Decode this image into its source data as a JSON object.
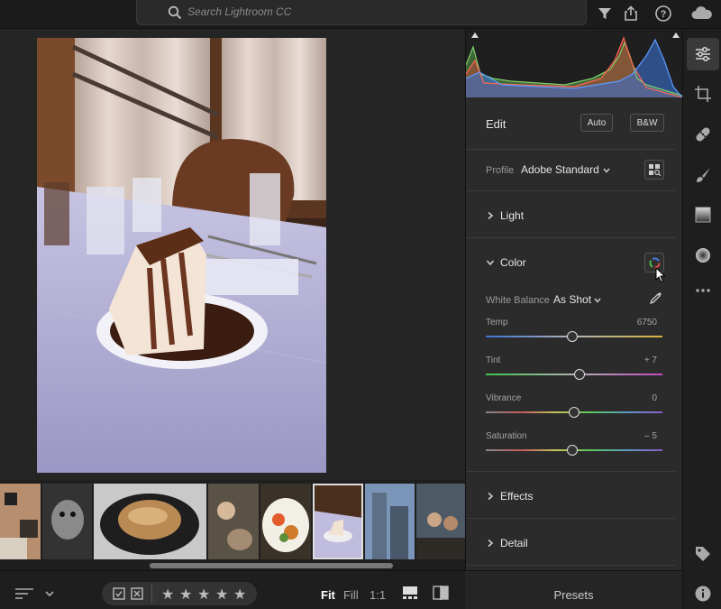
{
  "topbar": {
    "search_placeholder": "Search Lightroom CC",
    "icons": [
      "filter-icon",
      "share-icon",
      "help-icon",
      "cloud-icon"
    ]
  },
  "edit_panel": {
    "title": "Edit",
    "auto_label": "Auto",
    "bw_label": "B&W",
    "profile_label": "Profile",
    "profile_value": "Adobe Standard",
    "light_label": "Light",
    "color_label": "Color",
    "white_balance_label": "White Balance",
    "white_balance_value": "As Shot",
    "sliders": [
      {
        "label": "Temp",
        "value": "6750",
        "position": 0.49
      },
      {
        "label": "Tint",
        "value": "+ 7",
        "position": 0.53
      },
      {
        "label": "Vibrance",
        "value": "0",
        "position": 0.5
      },
      {
        "label": "Saturation",
        "value": "– 5",
        "position": 0.49
      }
    ],
    "effects_label": "Effects",
    "detail_label": "Detail"
  },
  "bottombar": {
    "stars": [
      "★",
      "★",
      "★",
      "★",
      "★"
    ],
    "fit_label": "Fit",
    "fill_label": "Fill",
    "one_to_one_label": "1:1"
  },
  "presets_label": "Presets",
  "filmstrip": {
    "thumbnails": [
      "street-collage",
      "cat-bw",
      "bread-pot",
      "people-cats",
      "breakfast-plate",
      "cake-selected",
      "city-buildings",
      "cafe-people"
    ],
    "selected_index": 5
  },
  "toolstrip": [
    "edit-sliders-icon",
    "crop-icon",
    "healing-icon",
    "brush-icon",
    "linear-gradient-icon",
    "radial-gradient-icon",
    "more-icon",
    "tag-icon",
    "info-icon"
  ]
}
